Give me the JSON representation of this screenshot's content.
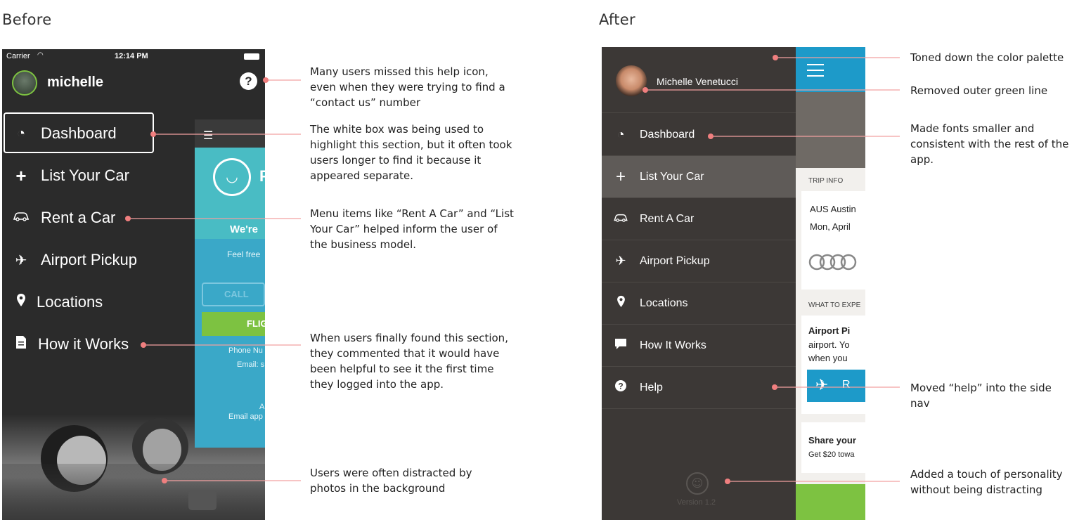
{
  "headings": {
    "before": "Before",
    "after": "After"
  },
  "before": {
    "status": {
      "carrier": "Carrier",
      "time": "12:14 PM"
    },
    "username": "michelle",
    "help": "?",
    "menu": [
      {
        "label": "Dashboard",
        "icon": "dashboard-icon"
      },
      {
        "label": "List Your Car",
        "icon": "plus-icon"
      },
      {
        "label": "Rent a Car",
        "icon": "car-icon"
      },
      {
        "label": "Airport Pickup",
        "icon": "plane-icon"
      },
      {
        "label": "Locations",
        "icon": "location-pin-icon"
      },
      {
        "label": "How it Works",
        "icon": "document-icon"
      }
    ],
    "app": {
      "logo_letter": "F",
      "headline": "We're",
      "sub": "Feel free",
      "call": "CALL",
      "flight": "FLIG",
      "phone": "Phone Nu",
      "email": "Email: s",
      "a_line": "A",
      "email_app": "Email app"
    }
  },
  "after": {
    "username": "Michelle Venetucci",
    "menu": [
      {
        "label": "Dashboard",
        "icon": "dashboard-icon"
      },
      {
        "label": "List Your Car",
        "icon": "plus-icon"
      },
      {
        "label": "Rent A Car",
        "icon": "car-icon"
      },
      {
        "label": "Airport Pickup",
        "icon": "plane-icon"
      },
      {
        "label": "Locations",
        "icon": "location-pin-icon"
      },
      {
        "label": "How It Works",
        "icon": "chat-bubble-icon"
      },
      {
        "label": "Help",
        "icon": "help-icon"
      }
    ],
    "version": "Version 1.2",
    "content": {
      "trip_info": "TRIP INFO",
      "aus": "AUS Austin",
      "date": "Mon, April",
      "what": "WHAT TO EXPE",
      "card2_title": "Airport Pi",
      "card2_line1": "airport. Yo",
      "card2_line2": "when you",
      "btn_letter": "R",
      "card3_title": "Share your",
      "card3_line": "Get $20 towa"
    }
  },
  "annotations": {
    "help_icon": [
      "Many users missed this help icon,",
      "even when they were trying to find a",
      "“contact us” number"
    ],
    "white_box": [
      "The white box was being used to",
      "highlight this section, but it often took",
      "users longer to find it because it",
      "appeared separate."
    ],
    "menu_items": [
      "Menu items like “Rent A Car” and “List",
      "Your Car” helped inform the user of",
      "the business model."
    ],
    "how_it_works": [
      "When users finally found this section,",
      "they commented that it would have",
      "been helpful to see it the first time",
      "they logged into the app."
    ],
    "photos": [
      "Users were often distracted by",
      "photos in the background"
    ],
    "palette": [
      "Toned down the color palette"
    ],
    "green_line": [
      "Removed outer green line"
    ],
    "fonts": [
      "Made fonts smaller and",
      "consistent with the rest of the",
      "app."
    ],
    "help_nav": [
      "Moved “help” into the side nav"
    ],
    "personality": [
      "Added a touch of personality",
      "without being distracting"
    ]
  },
  "colors": {
    "accent_line": "#f08a8a",
    "nav_bg": "#3c3836",
    "blue": "#1d9ac9",
    "green": "#7dc241"
  }
}
